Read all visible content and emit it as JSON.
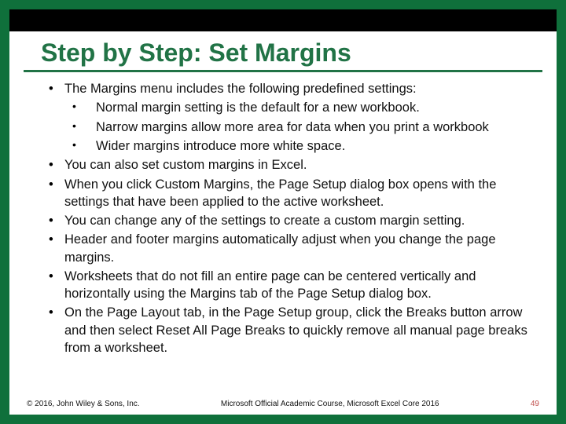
{
  "title": "Step by Step: Set Margins",
  "bullets": {
    "b1": "The Margins menu includes the following predefined settings:",
    "b1a": "Normal margin setting is the default for a new workbook.",
    "b1b": "Narrow margins allow more area for data when you print a workbook",
    "b1c": "Wider margins introduce more white space.",
    "b2": "You can also set custom margins in Excel.",
    "b3": "When you click Custom Margins, the Page Setup dialog box opens with the settings that have been applied to the active worksheet.",
    "b4": "You can change any of the settings to create a custom margin setting.",
    "b5": "Header and footer margins automatically adjust when you change the page margins.",
    "b6": "Worksheets that do not fill an entire page can be centered vertically and horizontally using the Margins tab of the Page Setup dialog box.",
    "b7": "On the Page Layout tab, in the Page Setup group, click the Breaks button arrow and then select Reset All Page Breaks to quickly remove all manual page breaks from a worksheet."
  },
  "footer": {
    "left": "© 2016, John Wiley & Sons, Inc.",
    "center": "Microsoft Official Academic Course, Microsoft Excel Core 2016",
    "page": "49"
  }
}
